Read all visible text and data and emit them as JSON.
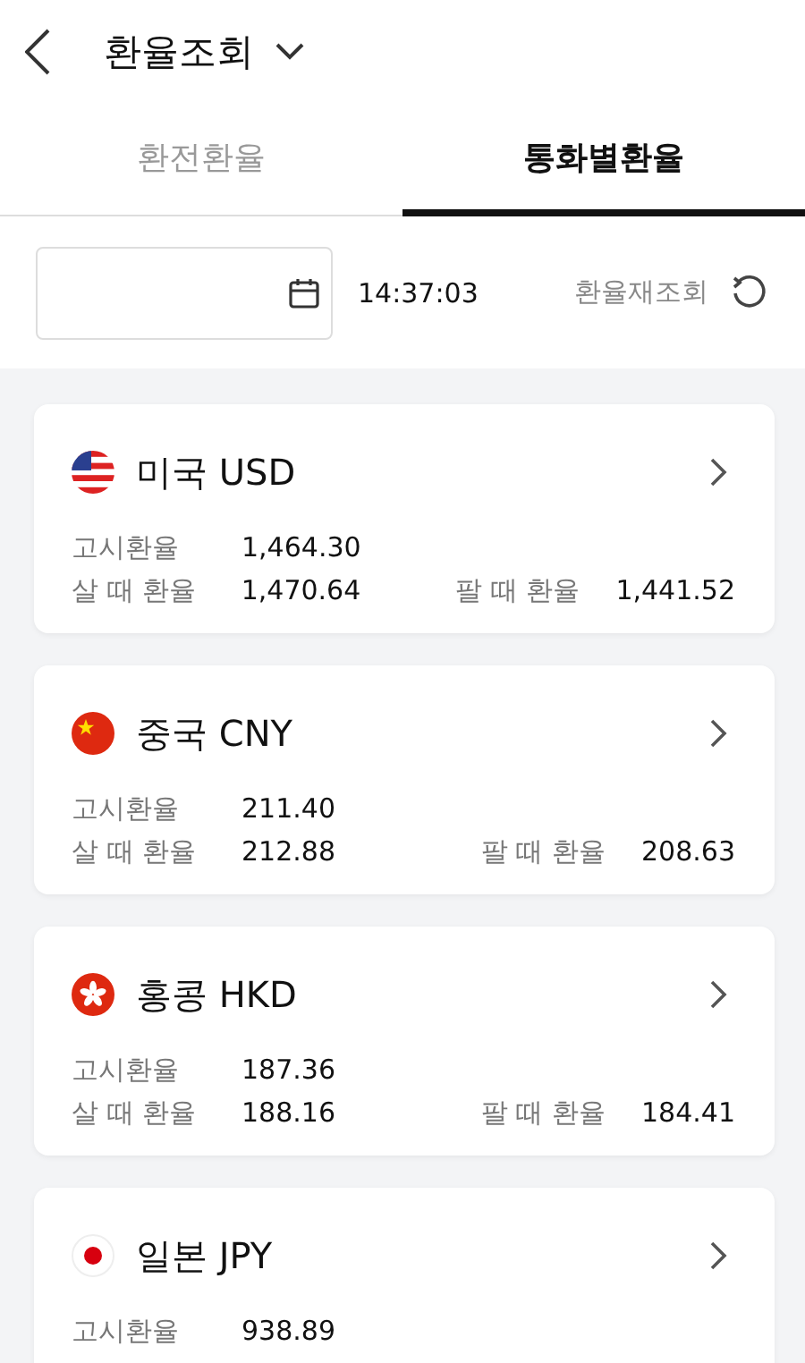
{
  "header": {
    "title": "환율조회"
  },
  "tabs": [
    {
      "label": "환전환율",
      "selected": false
    },
    {
      "label": "통화별환율",
      "selected": true
    }
  ],
  "toolbar": {
    "time": "14:37:03",
    "refresh_label": "환율재조회"
  },
  "currencies": [
    {
      "kind": "us",
      "name": "미국 USD",
      "rows": [
        {
          "label": "고시환율",
          "value": "1,464.30"
        },
        {
          "label": "살 때 환율",
          "value": "1,470.64",
          "label_2": "팔 때 환율",
          "value_2": "1,441.52"
        }
      ]
    },
    {
      "kind": "cn",
      "name": "중국 CNY",
      "rows": [
        {
          "label": "고시환율",
          "value": "211.40"
        },
        {
          "label": "살 때 환율",
          "value": "212.88",
          "label_2": "팔 때 환율",
          "value_2": "208.63"
        }
      ]
    },
    {
      "kind": "hk",
      "name": "홍콩 HKD",
      "rows": [
        {
          "label": "고시환율",
          "value": "187.36"
        },
        {
          "label": "살 때 환율",
          "value": "188.16",
          "label_2": "팔 때 환율",
          "value_2": "184.41"
        }
      ]
    },
    {
      "kind": "jp",
      "name": "일본 JPY",
      "rows": [
        {
          "label": "고시환율",
          "value": "938.89"
        }
      ]
    }
  ]
}
